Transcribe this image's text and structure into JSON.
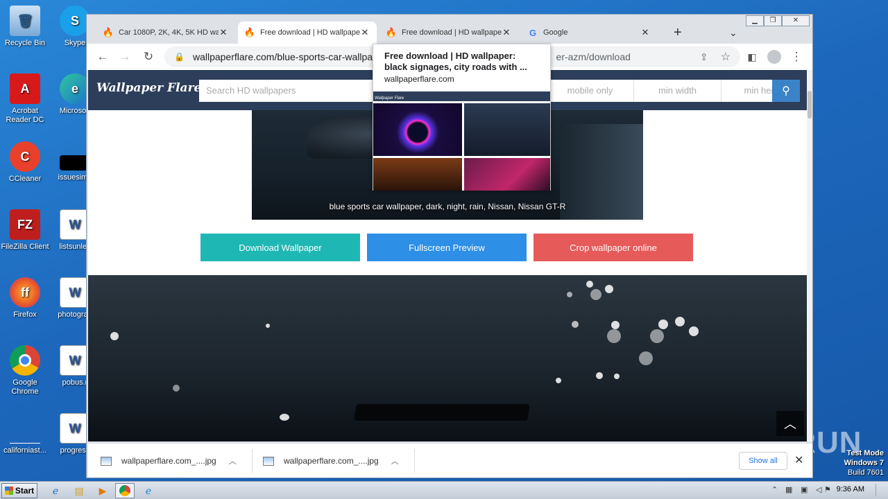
{
  "desktop": {
    "icons": [
      {
        "label": "Recycle Bin",
        "icon": "recycle-bin-icon"
      },
      {
        "label": "Acrobat Reader DC",
        "icon": "acrobat-icon"
      },
      {
        "label": "CCleaner",
        "icon": "ccleaner-icon"
      },
      {
        "label": "FileZilla Client",
        "icon": "filezilla-icon"
      },
      {
        "label": "Firefox",
        "icon": "firefox-icon"
      },
      {
        "label": "Google Chrome",
        "icon": "chrome-icon"
      },
      {
        "label": "californiast...",
        "icon": "blank-file-icon"
      },
      {
        "label": "Skype",
        "icon": "skype-icon"
      },
      {
        "label": "Microsoft",
        "icon": "edge-icon"
      },
      {
        "label": "issuesimp",
        "icon": "file-icon"
      },
      {
        "label": "listsunles",
        "icon": "word-doc-icon"
      },
      {
        "label": "photograp",
        "icon": "word-doc-icon"
      },
      {
        "label": "pobus.r",
        "icon": "word-doc-icon"
      },
      {
        "label": "progress",
        "icon": "word-doc-icon"
      }
    ]
  },
  "browser": {
    "tabs": [
      {
        "title": "Car 1080P, 2K, 4K, 5K HD wa",
        "favicon": "flame-icon"
      },
      {
        "title": "Free download | HD wallpape",
        "favicon": "flame-icon",
        "active": true
      },
      {
        "title": "Free download | HD wallpape",
        "favicon": "flame-icon"
      },
      {
        "title": "Google",
        "favicon": "google-icon"
      }
    ],
    "new_tab": "+",
    "tab_list": "⌄",
    "url_left": "wallpaperflare.com/blue-sports-car-wallpaper",
    "url_right": "er-azm/download"
  },
  "hovercard": {
    "title": "Free download | HD wallpaper: black signages, city roads with ...",
    "domain": "wallpaperflare.com",
    "preview_logo": "Wallpaper Flare"
  },
  "site": {
    "logo": "Wallpaper Flare",
    "search_placeholder": "Search HD wallpapers",
    "mobile_only": "mobile only",
    "min_width": "min width",
    "min_height": "min height",
    "hero_caption": "blue sports car wallpaper, dark, night, rain, Nissan, Nissan GT-R",
    "buttons": {
      "download": "Download Wallpaper",
      "fullscreen": "Fullscreen Preview",
      "crop": "Crop wallpaper online"
    },
    "colors": {
      "download": "#1fb7b3",
      "fullscreen": "#2d8fe6",
      "crop": "#e65a5a",
      "header": "#2d3e5a"
    }
  },
  "downloads": {
    "items": [
      {
        "name": "wallpaperflare.com_....jpg"
      },
      {
        "name": "wallpaperflare.com_....jpg"
      }
    ],
    "show_all": "Show all"
  },
  "watermark": "ANY.RUN",
  "system": {
    "test_mode": "Test Mode",
    "os": "Windows 7",
    "build": "Build 7601",
    "start": "Start",
    "clock": "9:36 AM"
  }
}
